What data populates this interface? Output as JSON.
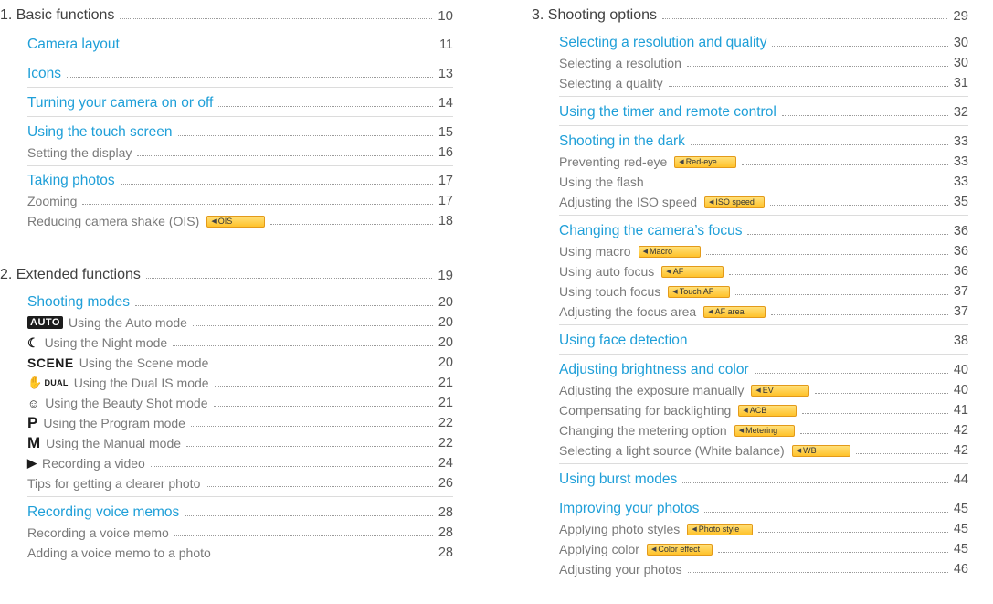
{
  "left_column": {
    "chapter1": {
      "title": "1. Basic functions",
      "page": "10"
    },
    "chapter1_entries": [
      {
        "text": "Camera layout",
        "page": "11"
      },
      {
        "text": "Icons",
        "page": "13"
      },
      {
        "text": "Turning your camera on or off",
        "page": "14"
      },
      {
        "text": "Using the touch screen",
        "page": "15"
      },
      {
        "text": "Setting the display",
        "page": "16"
      },
      {
        "text": "Taking photos",
        "page": "17"
      },
      {
        "text": "Zooming",
        "page": "17"
      },
      {
        "text": "Reducing camera shake (OIS)",
        "page": "18",
        "tag": "OIS"
      }
    ],
    "chapter2": {
      "title": "2. Extended functions",
      "page": "19"
    },
    "chapter2_entries": [
      {
        "text": "Shooting modes",
        "page": "20"
      },
      {
        "text": "Using the Auto mode",
        "page": "20",
        "icon": "AUTO",
        "icon_name": "auto-mode-icon"
      },
      {
        "text": "Using the Night mode",
        "page": "20",
        "icon": "☾",
        "icon_name": "night-mode-icon"
      },
      {
        "text": "Using the Scene mode",
        "page": "20",
        "icon": "SCENE",
        "icon_name": "scene-mode-icon"
      },
      {
        "text": "Using the Dual IS mode",
        "page": "21",
        "icon": "DUAL",
        "icon_name": "dual-is-mode-icon"
      },
      {
        "text": "Using the Beauty Shot mode",
        "page": "21",
        "icon": "☺",
        "icon_name": "beauty-shot-mode-icon"
      },
      {
        "text": "Using the Program mode",
        "page": "22",
        "icon": "P",
        "icon_name": "program-mode-icon"
      },
      {
        "text": "Using the Manual mode",
        "page": "22",
        "icon": "M",
        "icon_name": "manual-mode-icon"
      },
      {
        "text": "Recording a video",
        "page": "24",
        "icon": "▶",
        "icon_name": "video-mode-icon"
      },
      {
        "text": "Tips for getting a clearer photo",
        "page": "26"
      },
      {
        "text": "Recording voice memos",
        "page": "28"
      },
      {
        "text": "Recording a voice memo",
        "page": "28"
      },
      {
        "text": "Adding a voice memo to a photo",
        "page": "28"
      }
    ]
  },
  "right_column": {
    "chapter3": {
      "title": "3. Shooting options",
      "page": "29"
    },
    "entries": [
      {
        "text": "Selecting a resolution and quality",
        "page": "30"
      },
      {
        "text": "Selecting a resolution",
        "page": "30"
      },
      {
        "text": "Selecting a quality",
        "page": "31"
      },
      {
        "text": "Using the timer and remote control",
        "page": "32"
      },
      {
        "text": "Shooting in the dark",
        "page": "33"
      },
      {
        "text": "Preventing red-eye",
        "page": "33",
        "tag": "Red-eye"
      },
      {
        "text": "Using the flash",
        "page": "33"
      },
      {
        "text": "Adjusting the ISO speed",
        "page": "35",
        "tag": "ISO speed"
      },
      {
        "text": "Changing the camera’s focus",
        "page": "36"
      },
      {
        "text": "Using macro",
        "page": "36",
        "tag": "Macro"
      },
      {
        "text": "Using auto focus",
        "page": "36",
        "tag": "AF"
      },
      {
        "text": "Using touch focus",
        "page": "37",
        "tag": "Touch AF"
      },
      {
        "text": "Adjusting the focus area",
        "page": "37",
        "tag": "AF area"
      },
      {
        "text": "Using face detection",
        "page": "38"
      },
      {
        "text": "Adjusting brightness and color",
        "page": "40"
      },
      {
        "text": "Adjusting the exposure manually",
        "page": "40",
        "tag": "EV"
      },
      {
        "text": "Compensating for backlighting",
        "page": "41",
        "tag": "ACB"
      },
      {
        "text": "Changing the metering option",
        "page": "42",
        "tag": "Metering"
      },
      {
        "text": "Selecting a light source (White balance)",
        "page": "42",
        "tag": "WB"
      },
      {
        "text": "Using burst modes",
        "page": "44"
      },
      {
        "text": "Improving your photos",
        "page": "45"
      },
      {
        "text": "Applying photo styles",
        "page": "45",
        "tag": "Photo style"
      },
      {
        "text": "Applying color",
        "page": "45",
        "tag": "Color effect"
      },
      {
        "text": "Adjusting your photos",
        "page": "46"
      }
    ]
  },
  "colors": {
    "section": "#1f9fd8",
    "chapter": "#3f3f3f",
    "sub": "#7a7a7a",
    "tag_fill": "#ffc22a",
    "tag_border": "#e39a1a"
  }
}
